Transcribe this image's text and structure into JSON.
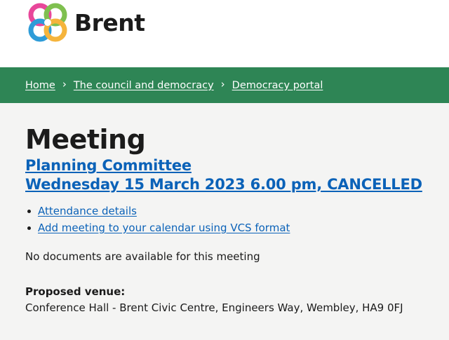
{
  "header": {
    "logo_text": "Brent",
    "logo_icon": "brent-knot-logo-icon",
    "logo_colors": [
      "#e8479a",
      "#f5b43c",
      "#2e9cd8",
      "#7fc04f"
    ]
  },
  "breadcrumb": {
    "items": [
      {
        "label": "Home"
      },
      {
        "label": "The council and democracy"
      },
      {
        "label": "Democracy portal"
      }
    ],
    "separator_icon": "chevron-right-icon",
    "bar_color": "#2e8555"
  },
  "main": {
    "title": "Meeting",
    "committee": "Planning Committee",
    "date_line": "Wednesday 15 March 2023 6.00 pm, CANCELLED",
    "links": [
      {
        "label": "Attendance details"
      },
      {
        "label": "Add meeting to your calendar using VCS format"
      }
    ],
    "no_documents": "No documents are available for this meeting",
    "venue_label": "Proposed venue:",
    "venue_address": "Conference Hall - Brent Civic Centre, Engineers Way, Wembley, HA9 0FJ"
  }
}
